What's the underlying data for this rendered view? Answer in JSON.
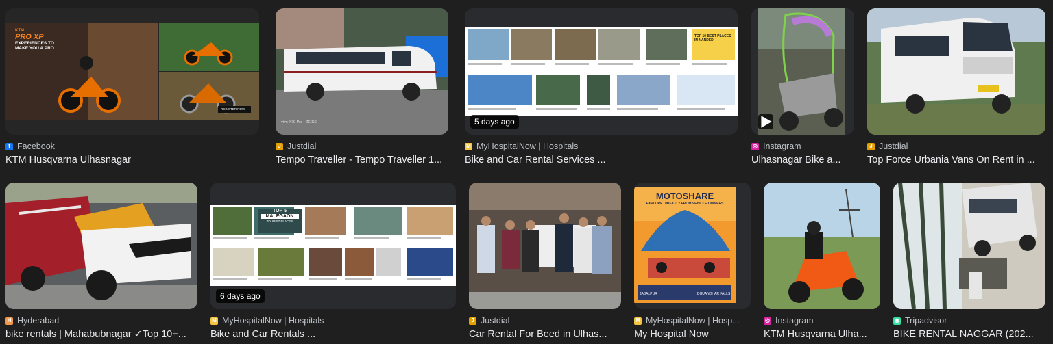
{
  "results": [
    {
      "source": "Facebook",
      "title": "KTM Husqvarna Ulhasnagar",
      "fav": {
        "color": "#1877f2",
        "glyph": "f"
      }
    },
    {
      "source": "Justdial",
      "title": "Tempo Traveller - Tempo Traveller 1...",
      "fav": {
        "color": "#e6a100",
        "glyph": "J"
      }
    },
    {
      "source": "MyHospitalNow | Hospitals",
      "title": "Bike and Car Rental Services ...",
      "fav": {
        "color": "#f5c542",
        "glyph": "M"
      },
      "badge": "5 days ago"
    },
    {
      "source": "Instagram",
      "title": "Ulhasnagar Bike a...",
      "fav": {
        "color": "#d6249f",
        "glyph": "◎"
      }
    },
    {
      "source": "Justdial",
      "title": "Top Force Urbania Vans On Rent in ...",
      "fav": {
        "color": "#e6a100",
        "glyph": "J"
      }
    },
    {
      "source": "Hyderabad",
      "title": "bike rentals | Mahabubnagar ✓Top 10+...",
      "fav": {
        "color": "#f2994a",
        "glyph": "H"
      }
    },
    {
      "source": "MyHospitalNow | Hospitals",
      "title": "Bike and Car Rentals ...",
      "fav": {
        "color": "#f5c542",
        "glyph": "M"
      },
      "badge": "6 days ago"
    },
    {
      "source": "Justdial",
      "title": "Car Rental For Beed in Ulhas...",
      "fav": {
        "color": "#e6a100",
        "glyph": "J"
      }
    },
    {
      "source": "MyHospitalNow | Hosp...",
      "title": "My Hospital Now",
      "fav": {
        "color": "#f5c542",
        "glyph": "M"
      }
    },
    {
      "source": "Instagram",
      "title": "KTM Husqvarna Ulha...",
      "fav": {
        "color": "#d6249f",
        "glyph": "◎"
      }
    },
    {
      "source": "Tripadvisor",
      "title": "BIKE RENTAL NAGGAR (202...",
      "fav": {
        "color": "#34e0a1",
        "glyph": "◉"
      }
    }
  ],
  "thumb_text": {
    "ktm_brand": "KTM",
    "ktm_heading": "PRO XP",
    "ktm_sub1": "EXPERIENCES TO",
    "ktm_sub2": "MAKE YOU A PRO",
    "ktm_cta": "REGISTER NOW",
    "tempo_caption": "vivo X70 Pro · ZEISS",
    "nanded_badge": "TOP 10 BEST PLACES IN NANDED",
    "malegaon_badge1": "TOP 5",
    "malegaon_badge2": "MALEGAON",
    "malegaon_badge3": "TOURIST PLACES",
    "moto_title": "MOTOSHARE",
    "moto_sub": "EXPLORE DIRECTLY FROM VEHICLE OWNERS",
    "moto_left": "JABALPUR",
    "moto_right": "DHUANDHAR FALLS"
  }
}
